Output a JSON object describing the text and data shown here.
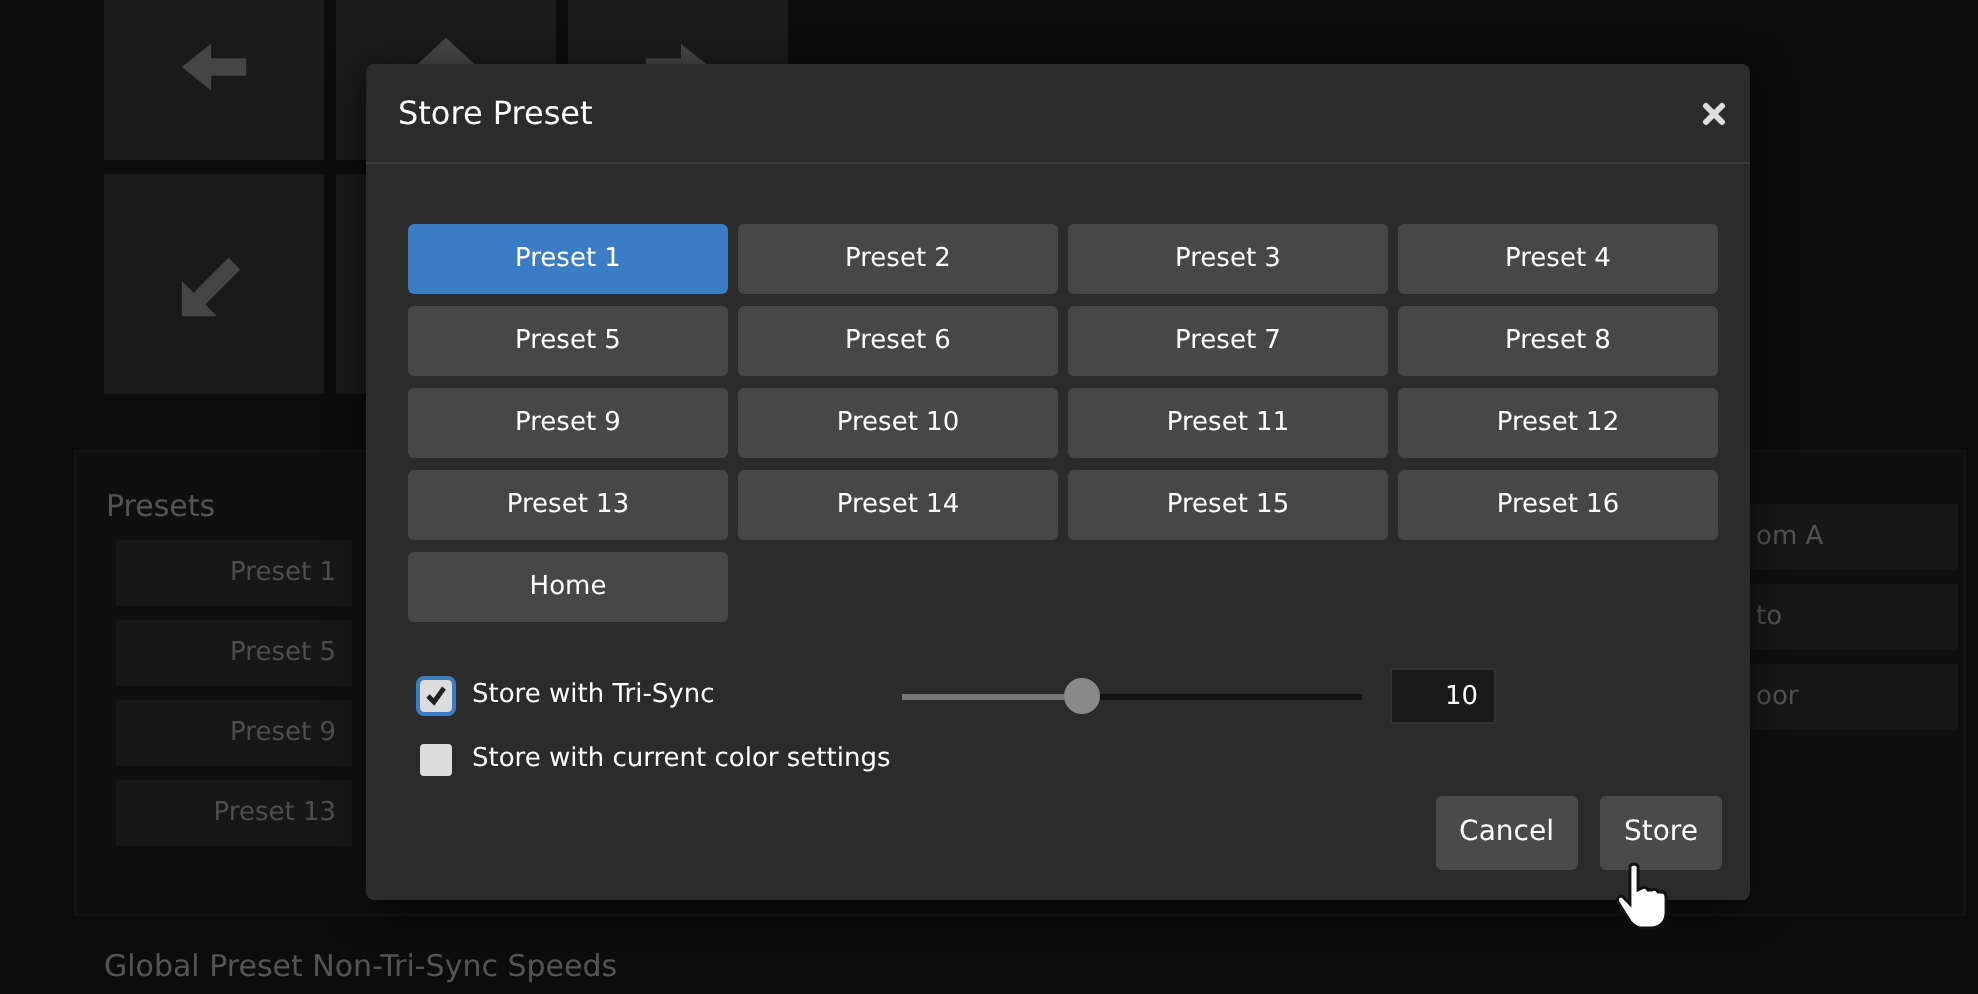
{
  "presets_panel": {
    "title": "Presets",
    "buttons": [
      "Preset 1",
      "Preset 5",
      "Preset 9",
      "Preset 13"
    ]
  },
  "right_buttons": [
    "om A",
    "to",
    "oor"
  ],
  "section_title": "Global Preset Non-Tri-Sync Speeds",
  "dialog": {
    "title": "Store Preset",
    "presets": [
      {
        "label": "Preset 1",
        "selected": true
      },
      {
        "label": "Preset 2",
        "selected": false
      },
      {
        "label": "Preset 3",
        "selected": false
      },
      {
        "label": "Preset 4",
        "selected": false
      },
      {
        "label": "Preset 5",
        "selected": false
      },
      {
        "label": "Preset 6",
        "selected": false
      },
      {
        "label": "Preset 7",
        "selected": false
      },
      {
        "label": "Preset 8",
        "selected": false
      },
      {
        "label": "Preset 9",
        "selected": false
      },
      {
        "label": "Preset 10",
        "selected": false
      },
      {
        "label": "Preset 11",
        "selected": false
      },
      {
        "label": "Preset 12",
        "selected": false
      },
      {
        "label": "Preset 13",
        "selected": false
      },
      {
        "label": "Preset 14",
        "selected": false
      },
      {
        "label": "Preset 15",
        "selected": false
      },
      {
        "label": "Preset 16",
        "selected": false
      },
      {
        "label": "Home",
        "selected": false
      }
    ],
    "options": [
      {
        "label": "Store with Tri-Sync",
        "checked": true
      },
      {
        "label": "Store with current color settings",
        "checked": false
      }
    ],
    "speed": {
      "level": 0.39,
      "value": "10"
    },
    "buttons": [
      "Cancel",
      "Store"
    ]
  }
}
